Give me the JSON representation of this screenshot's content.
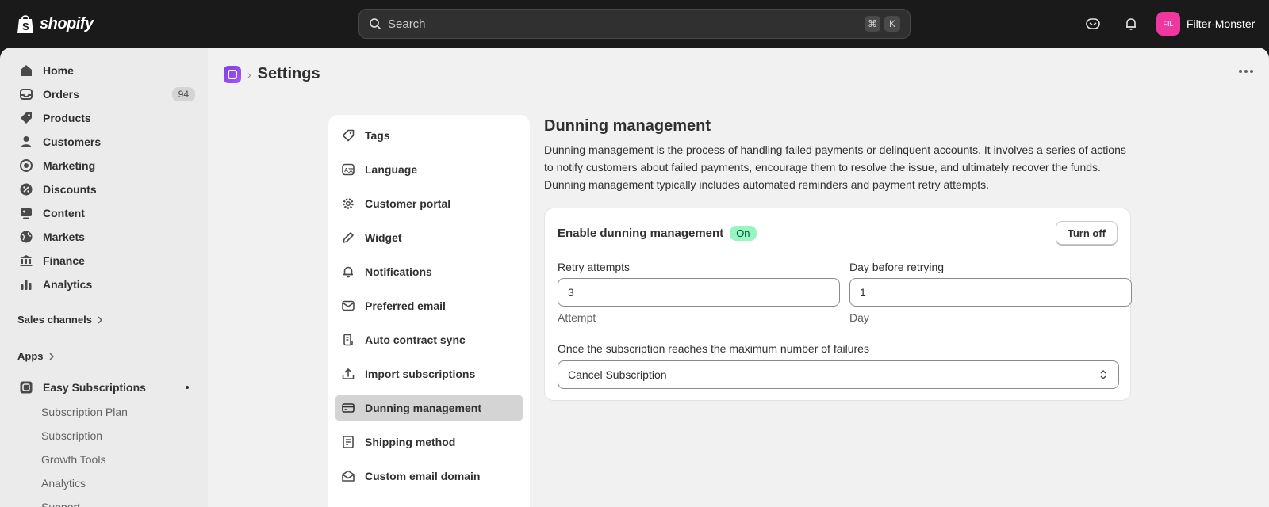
{
  "topbar": {
    "brand": "shopify",
    "search_placeholder": "Search",
    "shortcut_keys": [
      "⌘",
      "K"
    ],
    "store_initials": "FIL",
    "store_name": "Filter-Monster"
  },
  "sidebar": {
    "items": [
      {
        "label": "Home",
        "icon": "home-icon"
      },
      {
        "label": "Orders",
        "icon": "inbox-icon",
        "badge": "94"
      },
      {
        "label": "Products",
        "icon": "tag-icon"
      },
      {
        "label": "Customers",
        "icon": "person-icon"
      },
      {
        "label": "Marketing",
        "icon": "target-icon"
      },
      {
        "label": "Discounts",
        "icon": "discount-icon"
      },
      {
        "label": "Content",
        "icon": "content-icon"
      },
      {
        "label": "Markets",
        "icon": "globe-icon"
      },
      {
        "label": "Finance",
        "icon": "bank-icon"
      },
      {
        "label": "Analytics",
        "icon": "bar-chart-icon"
      }
    ],
    "sales_channels": "Sales channels",
    "apps": "Apps",
    "app_name": "Easy Subscriptions",
    "app_sub_items": [
      "Subscription Plan",
      "Subscription",
      "Growth Tools",
      "Analytics",
      "Support"
    ]
  },
  "page": {
    "title": "Settings"
  },
  "settings_menu": [
    {
      "label": "Tags",
      "icon": "tag-icon"
    },
    {
      "label": "Language",
      "icon": "language-icon"
    },
    {
      "label": "Customer portal",
      "icon": "gear-icon"
    },
    {
      "label": "Widget",
      "icon": "pencil-icon"
    },
    {
      "label": "Notifications",
      "icon": "bell-icon"
    },
    {
      "label": "Preferred email",
      "icon": "email-icon"
    },
    {
      "label": "Auto contract sync",
      "icon": "contract-icon"
    },
    {
      "label": "Import subscriptions",
      "icon": "upload-icon"
    },
    {
      "label": "Dunning management",
      "icon": "credit-card-icon",
      "active": true
    },
    {
      "label": "Shipping method",
      "icon": "receipt-icon"
    },
    {
      "label": "Custom email domain",
      "icon": "mail-open-icon"
    }
  ],
  "dunning": {
    "title": "Dunning management",
    "description": "Dunning management is the process of handling failed payments or delinquent accounts. It involves a series of actions to notify customers about failed payments, encourage them to resolve the issue, and ultimately recover the funds. Dunning management typically includes automated reminders and payment retry attempts.",
    "enable_label": "Enable dunning management",
    "status_badge": "On",
    "toggle_button": "Turn off",
    "retry_label": "Retry attempts",
    "retry_value": "3",
    "retry_help": "Attempt",
    "day_label": "Day before retrying",
    "day_value": "1",
    "day_help": "Day",
    "max_fail_label": "Once the subscription reaches the maximum number of failures",
    "max_fail_value": "Cancel Subscription"
  }
}
